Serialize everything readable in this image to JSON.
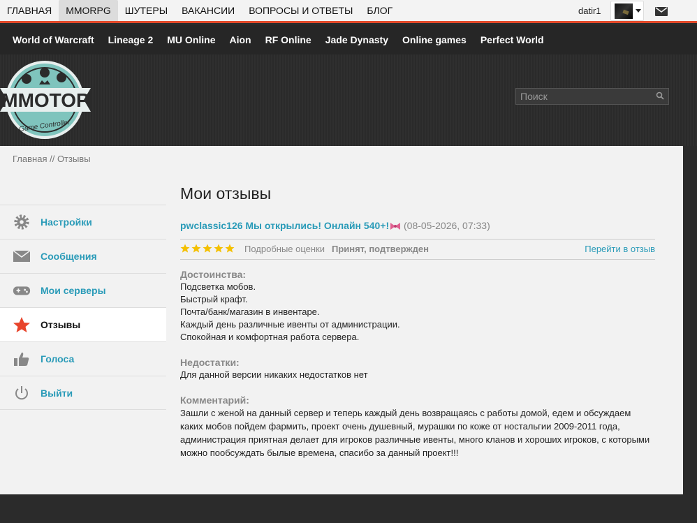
{
  "topnav": {
    "items": [
      "ГЛАВНАЯ",
      "MMORPG",
      "ШУТЕРЫ",
      "ВАКАНСИИ",
      "ВОПРОСЫ И ОТВЕТЫ",
      "БЛОГ"
    ],
    "active": "MMORPG",
    "username": "datir1"
  },
  "gamenav": {
    "items": [
      "World of Warcraft",
      "Lineage 2",
      "MU Online",
      "Aion",
      "RF Online",
      "Jade Dynasty",
      "Online games",
      "Perfect World"
    ]
  },
  "logo": {
    "text": "MMOTOP",
    "subtext": "Game Controller"
  },
  "search": {
    "placeholder": "Поиск"
  },
  "breadcrumb": {
    "home": "Главная",
    "separator": " // ",
    "current": "Отзывы"
  },
  "sidebar": {
    "items": [
      {
        "label": "Настройки",
        "icon": "gear-icon"
      },
      {
        "label": "Сообщения",
        "icon": "envelope-icon"
      },
      {
        "label": "Мои серверы",
        "icon": "gamepad-icon"
      },
      {
        "label": "Отзывы",
        "icon": "star-icon",
        "active": true
      },
      {
        "label": "Голоса",
        "icon": "thumbs-up-icon"
      },
      {
        "label": "Выйти",
        "icon": "power-icon"
      }
    ]
  },
  "page": {
    "title": "Мои отзывы"
  },
  "review": {
    "title": "pwclassic126 Мы открылись! Онлайн 540+!",
    "date": "(08-05-2026, 07:33)",
    "rating": 5,
    "detailed_label": "Подробные оценки",
    "status": "Принят, подтвержден",
    "goto_label": "Перейти в отзыв",
    "pros_label": "Достоинства:",
    "pros": [
      "Подсветка мобов.",
      "Быстрый крафт.",
      "Почта/банк/магазин в инвентаре.",
      "Каждый день различные ивенты от администрации.",
      "Спокойная и комфортная работа сервера."
    ],
    "cons_label": "Недостатки:",
    "cons": "Для данной версии никаких недостатков нет",
    "comment_label": "Комментарий:",
    "comment": "Зашли с женой на данный сервер и теперь каждый день возвращаясь с работы домой, едем и обсуждаем каких мобов пойдем фармить, проект очень душевный, мурашки по коже от ностальгии 2009-2011 года, администрация приятная делает для игроков различные ивенты, много кланов и хороших игроков, с которыми можно пообсуждать былые времена, спасибо за данный проект!!!"
  },
  "colors": {
    "accent": "#2a9bb8",
    "topline": "#e24a2b",
    "star": "#f4c000",
    "active_icon": "#e8442b"
  }
}
